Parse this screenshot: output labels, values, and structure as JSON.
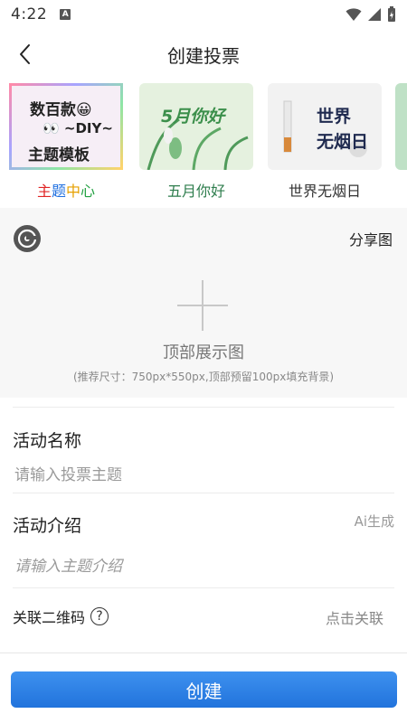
{
  "status": {
    "time": "4:22",
    "notif_letter": "A"
  },
  "header": {
    "title": "创建投票"
  },
  "templates": [
    {
      "label_parts": [
        {
          "text": "主",
          "color": "#e02424"
        },
        {
          "text": "题",
          "color": "#1f6fe0"
        },
        {
          "text": "中",
          "color": "#e6a000"
        },
        {
          "text": "心",
          "color": "#20a040"
        }
      ],
      "thumb_lines": [
        "数百款😀",
        "👀 ~DIY~",
        "主题模板"
      ]
    },
    {
      "label": "五月你好",
      "label_color": "#2e7d4d",
      "thumb_text": "5月你好"
    },
    {
      "label": "世界无烟日",
      "thumb_text1": "世界",
      "thumb_text2": "无烟日"
    }
  ],
  "banner": {
    "share_label": "分享图",
    "hint_title": "顶部展示图",
    "hint_sub": "(推荐尺寸：750px*550px,顶部预留100px填充背景)"
  },
  "form": {
    "name_label": "活动名称",
    "name_placeholder": "请输入投票主题",
    "intro_label": "活动介绍",
    "intro_ai": "Ai生成",
    "intro_placeholder": "请输入主题介绍",
    "qr_label": "关联二维码",
    "qr_help": "?",
    "qr_action": "点击关联"
  },
  "footer": {
    "create_label": "创建"
  },
  "colors": {
    "primary": "#2a7fe6",
    "bg_gray": "#f7f7f7"
  }
}
